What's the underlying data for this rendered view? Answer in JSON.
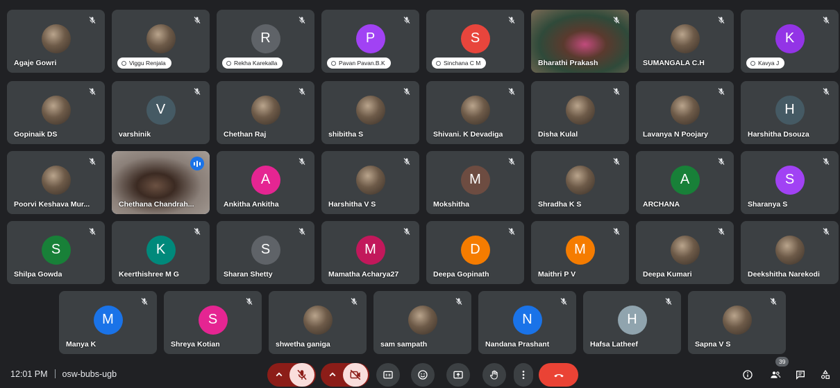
{
  "participants": [
    {
      "name": "Agaje Gowri",
      "type": "photo"
    },
    {
      "name": "Viggu Renjala",
      "type": "photo",
      "pill": true
    },
    {
      "name": "Rekha Karekalla",
      "type": "initial",
      "initial": "R",
      "color": "#5f6368",
      "pill": true
    },
    {
      "name": "Pavan Pavan.B.K",
      "type": "initial",
      "initial": "P",
      "color": "#a142f4",
      "pill": true
    },
    {
      "name": "Sinchana C M",
      "type": "initial",
      "initial": "S",
      "color": "#e8453c",
      "pill": true
    },
    {
      "name": "Bharathi Prakash",
      "type": "video"
    },
    {
      "name": "SUMANGALA C.H",
      "type": "photo"
    },
    {
      "name": "Kavya J",
      "type": "initial",
      "initial": "K",
      "color": "#9334e6",
      "pill": true
    },
    {
      "name": "Gopinaik DS",
      "type": "photo"
    },
    {
      "name": "varshinik",
      "type": "initial",
      "initial": "V",
      "color": "#455a64"
    },
    {
      "name": "Chethan Raj",
      "type": "photo"
    },
    {
      "name": "shibitha S",
      "type": "photo"
    },
    {
      "name": "Shivani. K Devadiga",
      "type": "photo"
    },
    {
      "name": "Disha Kulal",
      "type": "photo"
    },
    {
      "name": "Lavanya N Poojary",
      "type": "photo"
    },
    {
      "name": "Harshitha Dsouza",
      "type": "initial",
      "initial": "H",
      "color": "#455a64"
    },
    {
      "name": "Poorvi Keshava Mur...",
      "type": "photo"
    },
    {
      "name": "Chethana Chandrah...",
      "type": "video",
      "active": true,
      "speaking": true
    },
    {
      "name": "Ankitha Ankitha",
      "type": "initial",
      "initial": "A",
      "color": "#e52592"
    },
    {
      "name": "Harshitha V S",
      "type": "photo"
    },
    {
      "name": "Mokshitha",
      "type": "initial",
      "initial": "M",
      "color": "#6d4c41"
    },
    {
      "name": "Shradha K S",
      "type": "photo"
    },
    {
      "name": "ARCHANA",
      "type": "initial",
      "initial": "A",
      "color": "#188038"
    },
    {
      "name": "Sharanya S",
      "type": "initial",
      "initial": "S",
      "color": "#a142f4"
    },
    {
      "name": "Shilpa Gowda",
      "type": "initial",
      "initial": "S",
      "color": "#188038"
    },
    {
      "name": "Keerthishree M G",
      "type": "initial",
      "initial": "K",
      "color": "#00897b"
    },
    {
      "name": "Sharan Shetty",
      "type": "initial",
      "initial": "S",
      "color": "#5f6368"
    },
    {
      "name": "Mamatha Acharya27",
      "type": "initial",
      "initial": "M",
      "color": "#c2185b"
    },
    {
      "name": "Deepa Gopinath",
      "type": "initial",
      "initial": "D",
      "color": "#f57c00"
    },
    {
      "name": "Maithri P V",
      "type": "initial",
      "initial": "M",
      "color": "#f57c00"
    },
    {
      "name": "Deepa Kumari",
      "type": "photo"
    },
    {
      "name": "Deekshitha Narekodi",
      "type": "photo"
    },
    {
      "name": "Manya K",
      "type": "initial",
      "initial": "M",
      "color": "#1a73e8"
    },
    {
      "name": "Shreya Kotian",
      "type": "initial",
      "initial": "S",
      "color": "#e52592"
    },
    {
      "name": "shwetha ganiga",
      "type": "photo"
    },
    {
      "name": "sam sampath",
      "type": "photo"
    },
    {
      "name": "Nandana Prashant",
      "type": "initial",
      "initial": "N",
      "color": "#1a73e8"
    },
    {
      "name": "Hafsa Latheef",
      "type": "initial",
      "initial": "H",
      "color": "#90a4ae"
    },
    {
      "name": "Sapna V S",
      "type": "photo"
    }
  ],
  "bottom_bar": {
    "time": "12:01 PM",
    "meeting_code": "osw-bubs-ugb",
    "people_count": "39"
  },
  "colors": {
    "background": "#202124",
    "tile": "#3c4043",
    "mic_off_red": "#ea4335",
    "control_dark_red": "#8c1d18",
    "end_call_red": "#ea4335",
    "control_gray": "#3c4043"
  },
  "controls": [
    {
      "name": "mic-options-chevron-icon"
    },
    {
      "name": "mic-off-icon"
    },
    {
      "name": "camera-options-chevron-icon"
    },
    {
      "name": "camera-off-icon"
    },
    {
      "name": "captions-icon"
    },
    {
      "name": "emoji-icon"
    },
    {
      "name": "present-screen-icon"
    },
    {
      "name": "raise-hand-icon"
    },
    {
      "name": "more-options-icon"
    },
    {
      "name": "end-call-icon"
    },
    {
      "name": "info-icon"
    },
    {
      "name": "people-icon"
    },
    {
      "name": "chat-icon"
    },
    {
      "name": "activities-icon"
    }
  ]
}
